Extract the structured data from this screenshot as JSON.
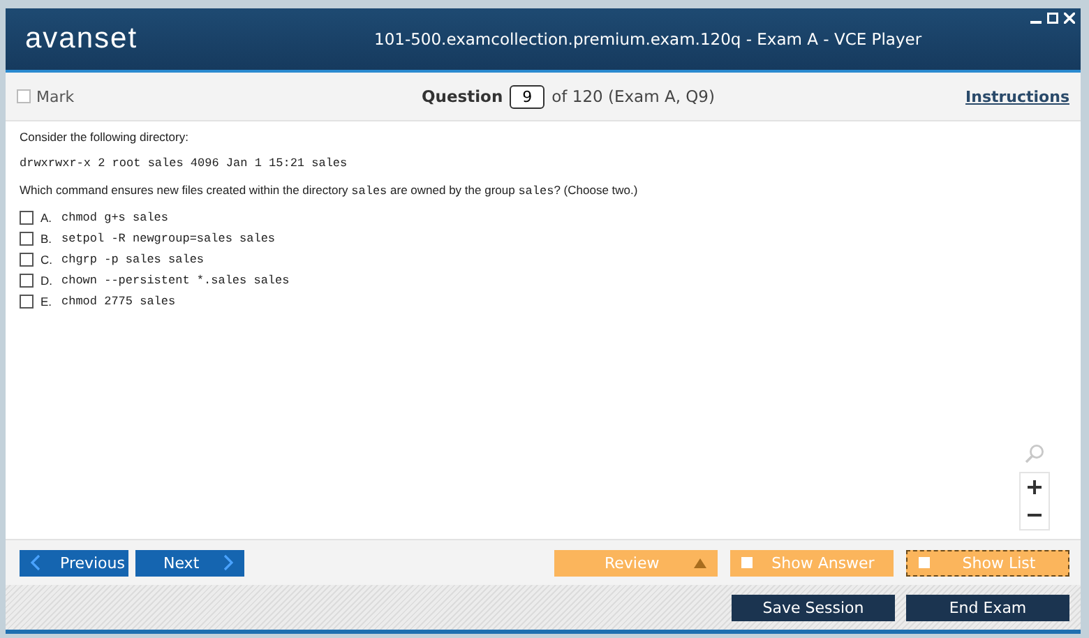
{
  "window": {
    "logo": "avanset",
    "title": "101-500.examcollection.premium.exam.120q - Exam A - VCE Player"
  },
  "toolbar": {
    "mark": {
      "label": "Mark",
      "checked": false
    },
    "question_label": "Question",
    "question_number": "9",
    "question_of": "of 120 (Exam A, Q9)",
    "instructions": "Instructions"
  },
  "question": {
    "intro": "Consider the following directory:",
    "listing": "drwxrwxr-x 2 root sales 4096 Jan 1 15:21 sales",
    "prompt": [
      {
        "kind": "text",
        "text": "Which command ensures new files created within the directory "
      },
      {
        "kind": "code",
        "text": "sales"
      },
      {
        "kind": "text",
        "text": " are owned by the group "
      },
      {
        "kind": "code",
        "text": "sales"
      },
      {
        "kind": "text",
        "text": "? (Choose two.)"
      }
    ],
    "options": [
      {
        "letter": "A.",
        "text": "chmod g+s sales",
        "checked": false
      },
      {
        "letter": "B.",
        "text": "setpol -R newgroup=sales sales",
        "checked": false
      },
      {
        "letter": "C.",
        "text": "chgrp -p sales sales",
        "checked": false
      },
      {
        "letter": "D.",
        "text": "chown --persistent *.sales sales",
        "checked": false
      },
      {
        "letter": "E.",
        "text": "chmod 2775 sales",
        "checked": false
      }
    ]
  },
  "nav": {
    "previous": "Previous",
    "next": "Next",
    "review": "Review",
    "show_answer": {
      "label": "Show Answer",
      "checked": false
    },
    "show_list": {
      "label": "Show List",
      "checked": false
    }
  },
  "footer": {
    "save": "Save Session",
    "end": "End Exam"
  }
}
